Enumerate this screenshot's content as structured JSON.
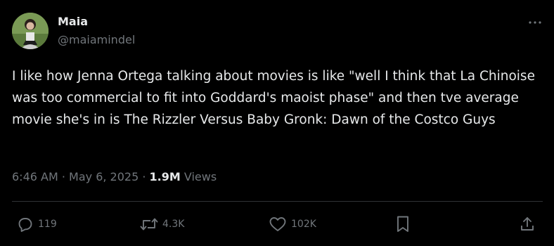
{
  "author": {
    "name": "Maia",
    "handle": "@maiamindel"
  },
  "tweet": {
    "text": "I like how Jenna Ortega talking about movies is like \"well I think that La Chinoise was too commercial to fit into Goddard's maoist phase\" and then tve average movie she's in is The Rizzler Versus Baby Gronk: Dawn of the Costco Guys"
  },
  "meta": {
    "time": "6:46 AM",
    "separator1": " · ",
    "date": "May 6, 2025",
    "separator2": " · ",
    "views_count": "1.9M",
    "views_label": " Views"
  },
  "actions": {
    "replies": "119",
    "reposts": "4.3K",
    "likes": "102K"
  },
  "icons": {
    "more": "more-horizontal-icon",
    "reply": "reply-bubble-icon",
    "repost": "repost-arrows-icon",
    "like": "heart-icon",
    "bookmark": "bookmark-icon",
    "share": "share-upload-icon"
  },
  "colors": {
    "background": "#000000",
    "text": "#e7e9ea",
    "secondary": "#71767b",
    "divider": "#2f3336"
  }
}
